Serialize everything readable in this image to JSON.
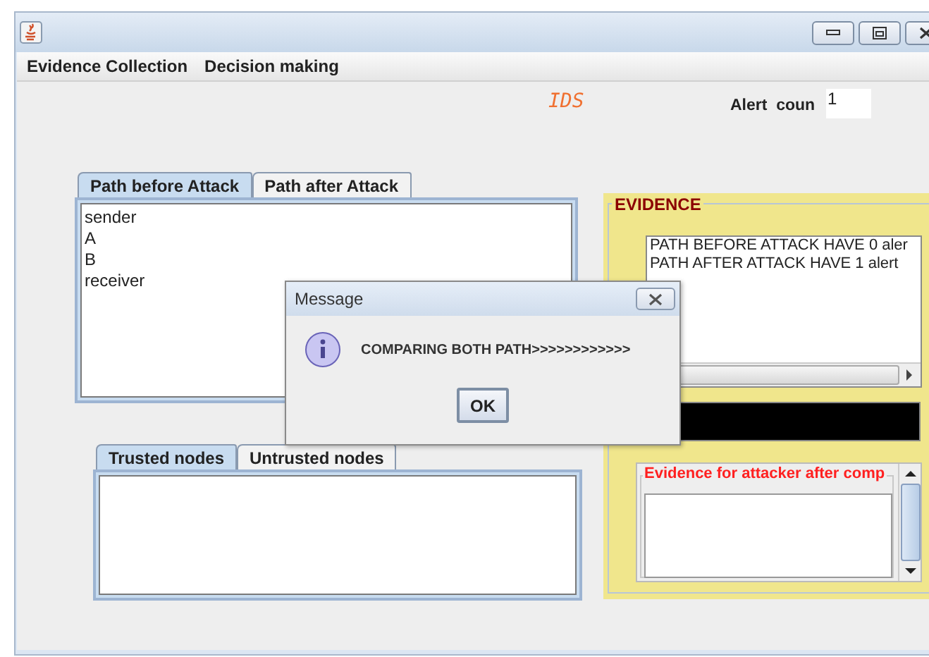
{
  "menu": [
    "Evidence Collection",
    "Decision making"
  ],
  "logo": "IDS",
  "alert": {
    "label": "Alert  coun",
    "value": "1"
  },
  "path_tabs": [
    {
      "label": "Path before Attack",
      "selected": true
    },
    {
      "label": "Path after Attack",
      "selected": false
    }
  ],
  "path_lines": [
    "sender",
    "A",
    "B",
    "receiver"
  ],
  "node_tabs": [
    {
      "label": "Trusted nodes",
      "selected": true
    },
    {
      "label": "Untrusted nodes",
      "selected": false
    }
  ],
  "evidence": {
    "title": "EVIDENCE",
    "lines": [
      "PATH BEFORE ATTACK HAVE 0 aler",
      "PATH AFTER ATTACK HAVE 1 alert"
    ],
    "attacker_title": "Evidence for attacker after comp"
  },
  "dialog": {
    "title": "Message",
    "message": "COMPARING BOTH PATH>>>>>>>>>>>>",
    "button": "OK"
  }
}
